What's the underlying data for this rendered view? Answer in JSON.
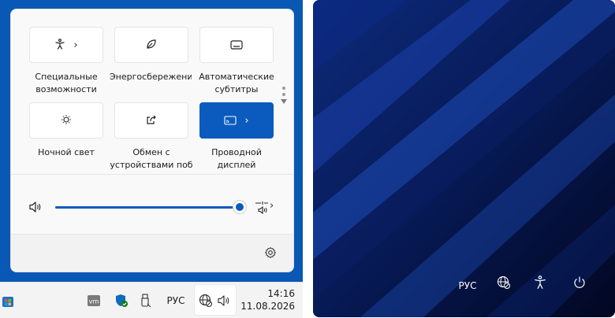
{
  "quick_settings": {
    "tiles": [
      {
        "id": "accessibility",
        "label": "Специальные\nвозможности",
        "icon": "accessibility-icon",
        "has_chevron": true,
        "active": false
      },
      {
        "id": "energy",
        "label": "Энергосбережени",
        "icon": "leaf-icon",
        "has_chevron": false,
        "active": false
      },
      {
        "id": "captions",
        "label": "Автоматические\nсубтитры",
        "icon": "captions-icon",
        "has_chevron": false,
        "active": false
      },
      {
        "id": "night-light",
        "label": "Ночной свет",
        "icon": "brightness-icon",
        "has_chevron": false,
        "active": false
      },
      {
        "id": "nearby-share",
        "label": "Обмен с\nустройствами поб",
        "icon": "share-icon",
        "has_chevron": false,
        "active": false
      },
      {
        "id": "cast",
        "label": "Проводной\nдисплей",
        "icon": "cast-icon",
        "has_chevron": true,
        "active": true
      }
    ],
    "chevron": "›",
    "volume": {
      "level_percent": 100,
      "more_chevron": "›"
    },
    "settings_icon": "gear-icon"
  },
  "taskbar": {
    "language": "РУС",
    "time": "14:16",
    "date": "11.08.2026"
  },
  "lock_screen": {
    "language": "РУС"
  },
  "colors": {
    "accent": "#0a5bbd",
    "frame_blue": "#0a58b5",
    "lock_bg": "#05123a"
  }
}
